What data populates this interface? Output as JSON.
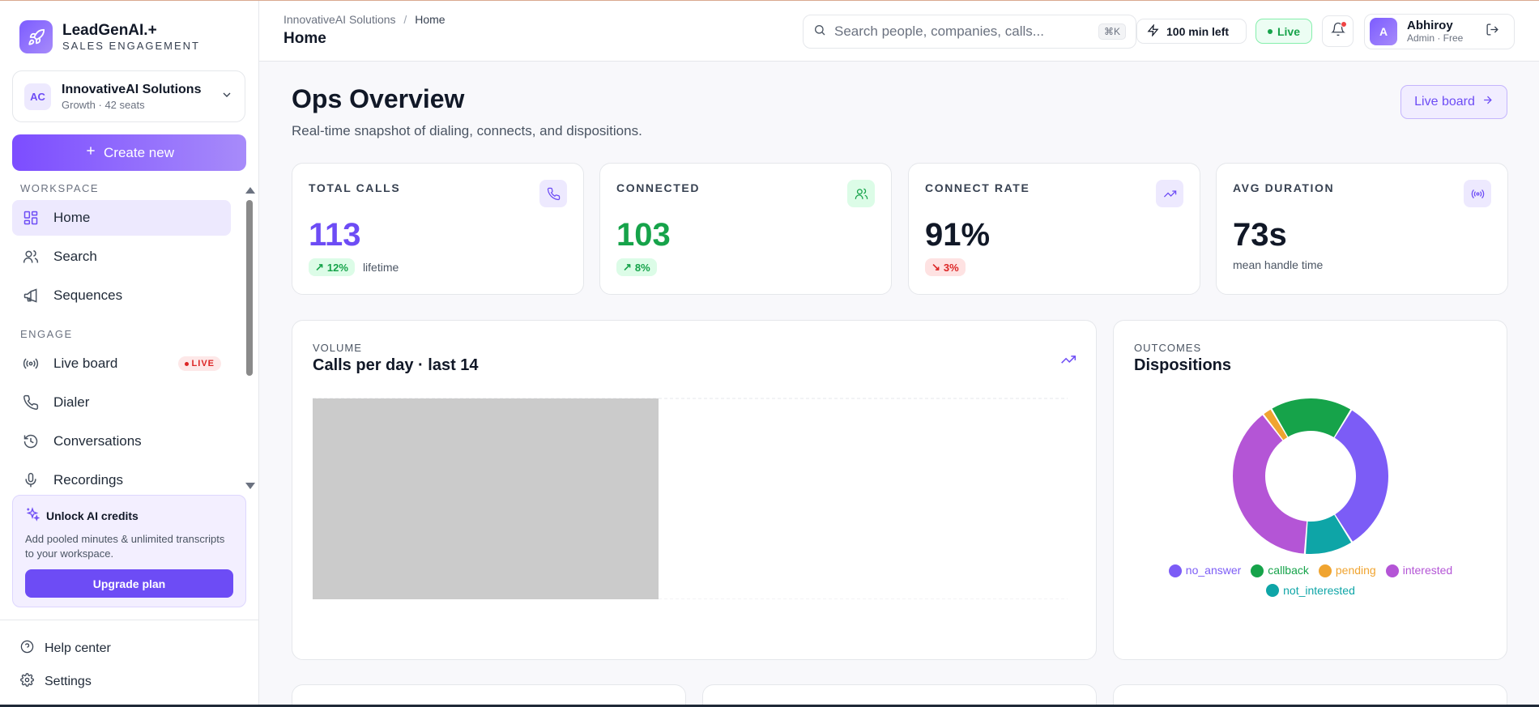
{
  "brand": {
    "name": "LeadGenAI.+",
    "subtitle": "SALES ENGAGEMENT"
  },
  "org": {
    "badge": "AC",
    "name": "InnovativeAI Solutions",
    "plan": "Growth · 42 seats"
  },
  "create_label": "Create new",
  "nav": {
    "workspace_label": "WORKSPACE",
    "engage_label": "ENGAGE",
    "workspace_items": [
      {
        "label": "Home",
        "icon": "grid-icon",
        "active": true
      },
      {
        "label": "Search",
        "icon": "users-icon"
      },
      {
        "label": "Sequences",
        "icon": "megaphone-icon"
      }
    ],
    "engage_items": [
      {
        "label": "Live board",
        "icon": "broadcast-icon",
        "badge": "LIVE"
      },
      {
        "label": "Dialer",
        "icon": "phone-icon"
      },
      {
        "label": "Conversations",
        "icon": "history-icon"
      },
      {
        "label": "Recordings",
        "icon": "mic-icon"
      }
    ]
  },
  "promo": {
    "title": "Unlock AI credits",
    "text": "Add pooled minutes & unlimited transcripts to your workspace.",
    "button": "Upgrade plan"
  },
  "footer": {
    "help": "Help center",
    "settings": "Settings"
  },
  "header": {
    "breadcrumb_root": "InnovativeAI Solutions",
    "breadcrumb_sep": "/",
    "breadcrumb_current": "Home",
    "page_title": "Home",
    "search_placeholder": "Search people, companies, calls...",
    "search_kbd": "⌘K",
    "minutes": "100 min left",
    "live": "Live",
    "user_initial": "A",
    "user_name": "Abhiroy",
    "user_role": "Admin · Free"
  },
  "main": {
    "title": "Ops Overview",
    "subtitle": "Real-time snapshot of dialing, connects, and dispositions.",
    "live_button": "Live board"
  },
  "kpis": [
    {
      "label": "TOTAL CALLS",
      "value": "113",
      "chip": "12%",
      "direction": "up",
      "note": "lifetime",
      "color": "#6d4cf5",
      "icon": "phone-icon"
    },
    {
      "label": "CONNECTED",
      "value": "103",
      "chip": "8%",
      "direction": "up",
      "note": "",
      "color": "#16a34a",
      "icon": "users-icon"
    },
    {
      "label": "CONNECT RATE",
      "value": "91%",
      "chip": "3%",
      "direction": "down",
      "note": "",
      "color": "#111827",
      "icon": "trend-up-icon"
    },
    {
      "label": "AVG DURATION",
      "value": "73s",
      "chip": "",
      "direction": "",
      "note": "mean handle time",
      "color": "#111827",
      "icon": "broadcast-icon"
    }
  ],
  "volume": {
    "kicker": "VOLUME",
    "title": "Calls per day · last 14"
  },
  "outcomes": {
    "kicker": "OUTCOMES",
    "title": "Dispositions"
  },
  "chart_data": {
    "type": "pie",
    "title": "Dispositions",
    "series": [
      {
        "name": "no_answer",
        "value": 32,
        "color": "#7c5cf6"
      },
      {
        "name": "not_interested",
        "value": 10,
        "color": "#0ea5a7"
      },
      {
        "name": "interested",
        "value": 38,
        "color": "#b455d6"
      },
      {
        "name": "pending",
        "value": 2,
        "color": "#f0a430"
      },
      {
        "name": "callback",
        "value": 17,
        "color": "#16a34a"
      }
    ],
    "legend": [
      "no_answer",
      "callback",
      "pending",
      "interested",
      "not_interested"
    ]
  }
}
